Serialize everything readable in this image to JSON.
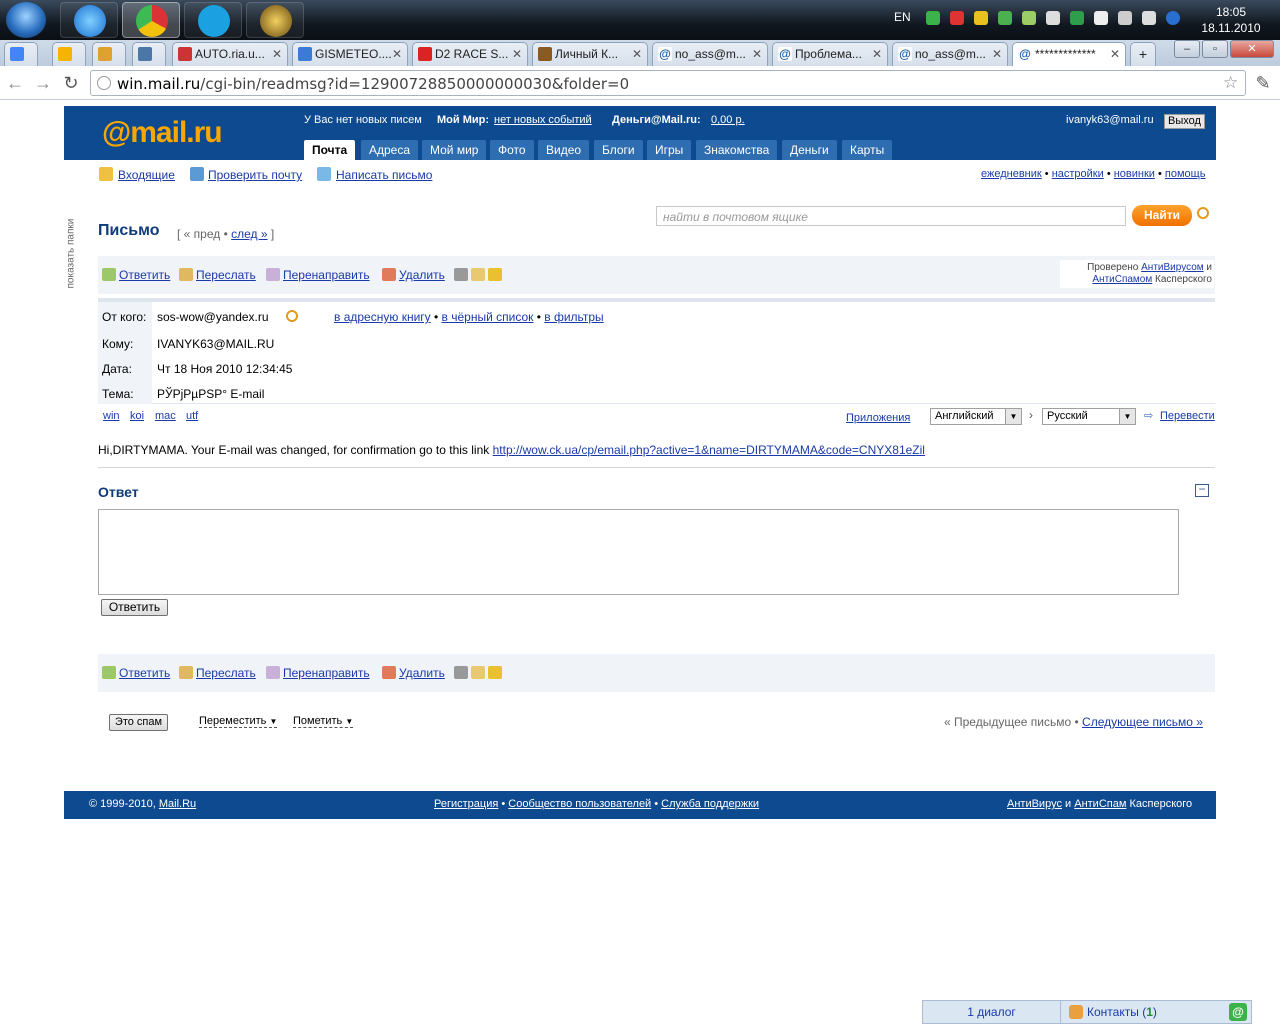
{
  "taskbar": {
    "apps": [
      "start-button",
      "itunes",
      "chrome",
      "skype",
      "warcraft"
    ],
    "lang": "EN",
    "clock_time": "18:05",
    "clock_date": "18.11.2010"
  },
  "browser": {
    "tabs": [
      {
        "title": ""
      },
      {
        "title": ""
      },
      {
        "title": ""
      },
      {
        "title": ""
      },
      {
        "title": "AUTO.ria.u..."
      },
      {
        "title": "GISMETEO...."
      },
      {
        "title": "D2 RACE S..."
      },
      {
        "title": "Личный К..."
      },
      {
        "title": "no_ass@m..."
      },
      {
        "title": "Проблема..."
      },
      {
        "title": "no_ass@m..."
      },
      {
        "title": "*************"
      }
    ],
    "url_host": "win.mail.ru",
    "url_path": "/cgi-bin/readmsg?id=12900728850000000030&folder=0"
  },
  "header": {
    "logo_at": "@mail",
    "logo_ru": ".ru",
    "no_new_letters": "У Вас нет новых писем",
    "moy_mir_label": "Мой Мир:",
    "moy_mir_link": "нет новых событий",
    "dengi_label": "Деньги@Mail.ru:",
    "dengi_value": "0,00 р.",
    "user_email": "ivanyk63@mail.ru",
    "exit": "Выход",
    "tabs": [
      "Почта",
      "Адреса",
      "Мой мир",
      "Фото",
      "Видео",
      "Блоги",
      "Игры",
      "Знакомства",
      "Деньги",
      "Карты"
    ]
  },
  "toolbar": {
    "inbox": "Входящие",
    "check_mail": "Проверить почту",
    "compose": "Написать письмо",
    "diary": "ежедневник",
    "settings": "настройки",
    "news": "новинки",
    "help": "помощь",
    "show_folders": "показать папки"
  },
  "search": {
    "placeholder": "найти в почтовом ящике",
    "button": "Найти"
  },
  "letter": {
    "title": "Письмо",
    "prev": "« пред",
    "next": "след »",
    "actions": {
      "reply": "Ответить",
      "forward": "Переслать",
      "redirect": "Перенаправить",
      "delete": "Удалить"
    },
    "kaspersky_checked": "Проверено",
    "kaspersky_av": "АнтиВирусом",
    "kaspersky_and": "и",
    "kaspersky_as": "АнтиСпамом",
    "kaspersky_name": "Касперского",
    "from_label": "От кого:",
    "from_value": "sos-wow@yandex.ru",
    "to_addressbook": "в адресную книгу",
    "to_blacklist": "в чёрный список",
    "to_filters": "в фильтры",
    "to_label": "Кому:",
    "to_value": "IVANYK63@MAIL.RU",
    "date_label": "Дата:",
    "date_value": "Чт 18 Ноя 2010 12:34:45",
    "subject_label": "Тема:",
    "subject_value": "РЎРјРµРЅР° E-mail",
    "encodings": [
      "win",
      "koi",
      "mac",
      "utf"
    ],
    "attachments": "Приложения",
    "lang_from": "Английский",
    "lang_to": "Русский",
    "translate": "Перевести",
    "body_text": "Hi,DIRTYMAMA. Your E-mail was changed, for confirmation go to this link",
    "body_link": "http://wow.ck.ua/cp/email.php?active=1&name=DIRTYMAMA&code=CNYX81eZil"
  },
  "reply": {
    "title": "Ответ",
    "collapse": "−",
    "send_button": "Ответить"
  },
  "bottom": {
    "spam_button": "Это спам",
    "move": "Переместить",
    "mark": "Пометить",
    "prev_letter": "« Предыдущее письмо",
    "next_letter": "Следующее письмо »"
  },
  "footer": {
    "copyright": "© 1999-2010,",
    "mailru": "Mail.Ru",
    "register": "Регистрация",
    "community": "Сообщество пользователей",
    "support": "Служба поддержки",
    "antivirus": "АнтиВирус",
    "and": "и",
    "antispam": "АнтиСпам",
    "kaspersky": "Касперского"
  },
  "chat": {
    "dialog": "1 диалог",
    "contacts": "Контакты",
    "contacts_count": "1",
    "contacts_open": "(",
    "contacts_close": ")"
  },
  "colors": {
    "brand_blue": "#0e4a8f",
    "brand_orange": "#f7a700",
    "link": "#1a3aa8"
  }
}
